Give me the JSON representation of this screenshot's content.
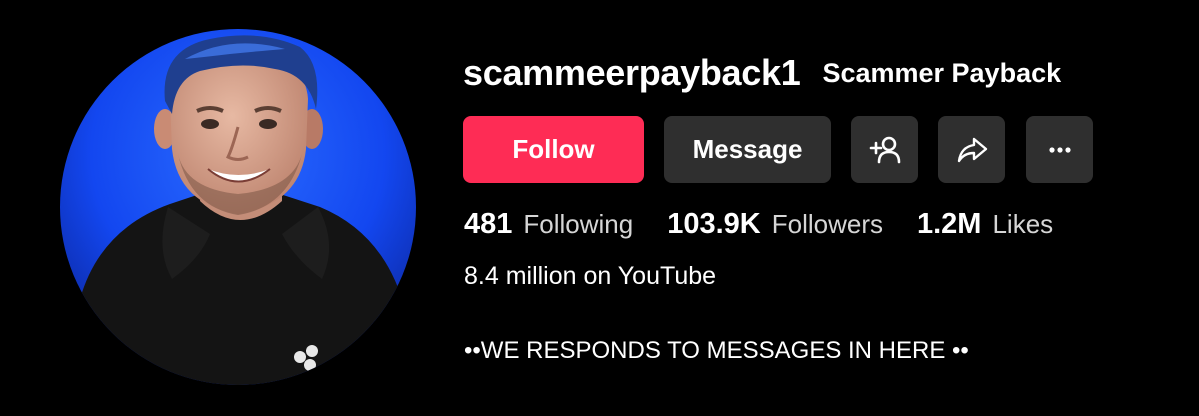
{
  "profile": {
    "handle": "scammeerpayback1",
    "display_name": "Scammer Payback",
    "avatar_icon": "profile-photo"
  },
  "actions": {
    "follow_label": "Follow",
    "message_label": "Message",
    "add_friend_icon": "add-friend-icon",
    "share_icon": "share-icon",
    "more_icon": "more-icon"
  },
  "stats": [
    {
      "value": "481",
      "label": "Following"
    },
    {
      "value": "103.9K",
      "label": "Followers"
    },
    {
      "value": "1.2M",
      "label": "Likes"
    }
  ],
  "bio": {
    "line1": "8.4 million on YouTube",
    "line2": "••WE RESPONDS TO MESSAGES IN HERE ••"
  },
  "colors": {
    "background": "#000000",
    "follow_button": "#fe2c55",
    "secondary_button": "#2f2f2f",
    "avatar_backdrop": "#1352ff"
  }
}
